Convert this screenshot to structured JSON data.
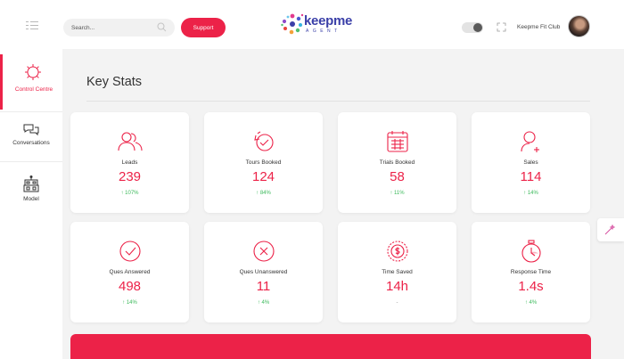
{
  "header": {
    "search_placeholder": "Search...",
    "support_label": "Support",
    "logo_word": "keepme",
    "logo_sub": "AGENT",
    "user_name": "Keepme Fit Club"
  },
  "sidebar": {
    "items": [
      {
        "label": "Control Centre",
        "icon": "control-centre-icon",
        "active": true
      },
      {
        "label": "Conversations",
        "icon": "chat-bubbles-icon",
        "active": false
      },
      {
        "label": "Model",
        "icon": "robot-icon",
        "active": false
      }
    ]
  },
  "main": {
    "title": "Key Stats",
    "stats": [
      {
        "label": "Leads",
        "value": "239",
        "change": "↑ 107%",
        "icon": "people-icon"
      },
      {
        "label": "Tours Booked",
        "value": "124",
        "change": "↑ 84%",
        "icon": "clock-check-icon"
      },
      {
        "label": "Trials Booked",
        "value": "58",
        "change": "↑ 11%",
        "icon": "calendar-icon"
      },
      {
        "label": "Sales",
        "value": "114",
        "change": "↑ 14%",
        "icon": "user-plus-icon"
      },
      {
        "label": "Ques Answered",
        "value": "498",
        "change": "↑ 14%",
        "icon": "check-circle-icon"
      },
      {
        "label": "Ques Unanswered",
        "value": "11",
        "change": "↑ 4%",
        "icon": "x-circle-icon"
      },
      {
        "label": "Time Saved",
        "value": "14h",
        "change": "-",
        "icon": "money-time-icon"
      },
      {
        "label": "Response Time",
        "value": "1.4s",
        "change": "↑ 4%",
        "icon": "stopwatch-icon"
      }
    ]
  },
  "colors": {
    "accent": "#ec2248",
    "positive": "#3dba5c",
    "logo": "#3a3fa8"
  }
}
